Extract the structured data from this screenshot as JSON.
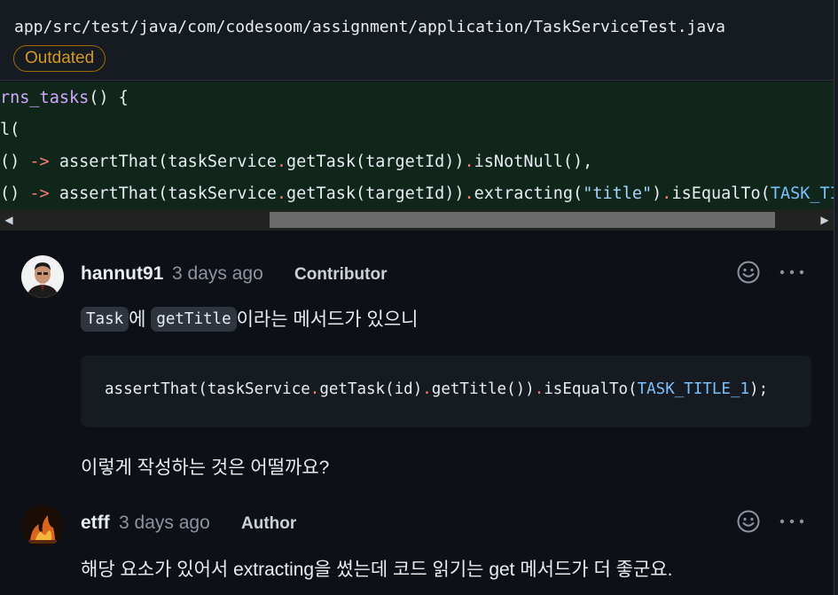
{
  "file": {
    "path": "app/src/test/java/com/codesoom/assignment/application/TaskServiceTest.java",
    "badge": "Outdated"
  },
  "code_lines": [
    {
      "parts": [
        {
          "t": "rns_tasks",
          "c": "fn"
        },
        {
          "t": "() {",
          "c": ""
        }
      ]
    },
    {
      "parts": [
        {
          "t": "l(",
          "c": ""
        }
      ]
    },
    {
      "parts": [
        {
          "t": "() ",
          "c": ""
        },
        {
          "t": "->",
          "c": "kw"
        },
        {
          "t": " assertThat(taskService",
          "c": ""
        },
        {
          "t": ".",
          "c": "kw"
        },
        {
          "t": "getTask(targetId))",
          "c": ""
        },
        {
          "t": ".",
          "c": "kw"
        },
        {
          "t": "isNotNull(),",
          "c": ""
        }
      ]
    },
    {
      "parts": [
        {
          "t": "() ",
          "c": ""
        },
        {
          "t": "->",
          "c": "kw"
        },
        {
          "t": " assertThat(taskService",
          "c": ""
        },
        {
          "t": ".",
          "c": "kw"
        },
        {
          "t": "getTask(targetId))",
          "c": ""
        },
        {
          "t": ".",
          "c": "kw"
        },
        {
          "t": "extracting(",
          "c": ""
        },
        {
          "t": "\"title\"",
          "c": "str"
        },
        {
          "t": ")",
          "c": ""
        },
        {
          "t": ".",
          "c": "kw"
        },
        {
          "t": "isEqualTo(",
          "c": ""
        },
        {
          "t": "TASK_TITLE",
          "c": "const"
        }
      ]
    }
  ],
  "scrollbar": {
    "left_arrow": "◀",
    "right_arrow": "▶"
  },
  "comments": [
    {
      "author": "hannut91",
      "time": "3 days ago",
      "role": "Contributor",
      "body_parts": [
        {
          "t": "Task",
          "code": true
        },
        {
          "t": "에 ",
          "code": false
        },
        {
          "t": "getTitle",
          "code": true
        },
        {
          "t": "이라는 메서드가 있으니",
          "code": false
        }
      ],
      "code_block_parts": [
        {
          "t": "assertThat(taskService",
          "c": ""
        },
        {
          "t": ".",
          "c": "kw"
        },
        {
          "t": "getTask(id)",
          "c": ""
        },
        {
          "t": ".",
          "c": "kw"
        },
        {
          "t": "getTitle())",
          "c": ""
        },
        {
          "t": ".",
          "c": "kw"
        },
        {
          "t": "isEqualTo(",
          "c": ""
        },
        {
          "t": "TASK_TITLE_1",
          "c": "const"
        },
        {
          "t": ");",
          "c": ""
        }
      ],
      "after_text": "이렇게 작성하는 것은 어떨까요?"
    },
    {
      "author": "etff",
      "time": "3 days ago",
      "role": "Author",
      "body": "해당 요소가 있어서 extracting을 썼는데 코드 읽기는 get 메서드가 더 좋군요."
    }
  ],
  "icons": {
    "reaction": "smiley-icon",
    "menu": "kebab-menu-icon"
  }
}
